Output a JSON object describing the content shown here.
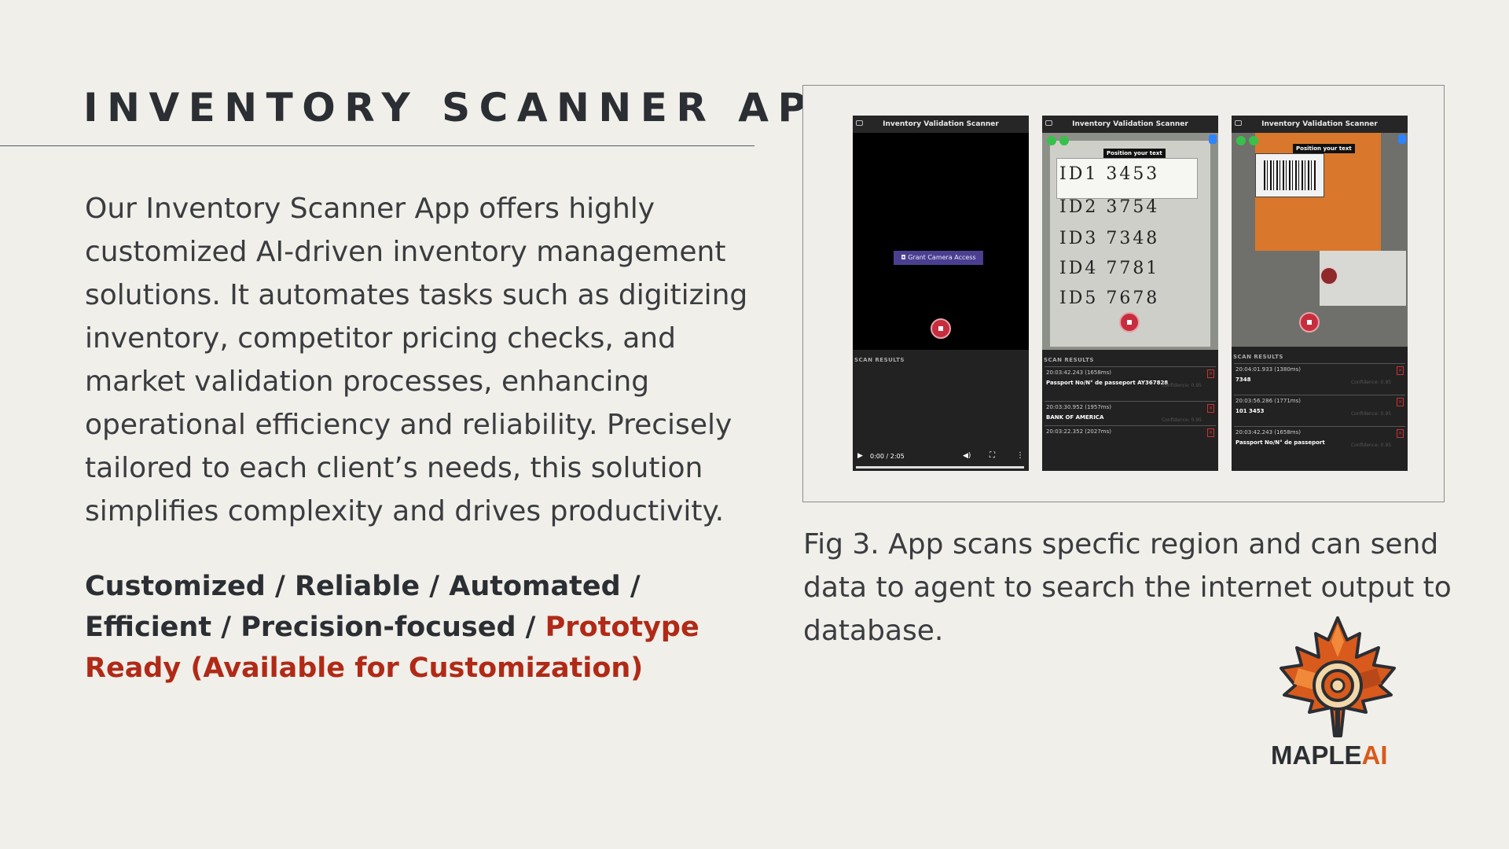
{
  "slide": {
    "title": "INVENTORY SCANNER APP",
    "description": "Our Inventory Scanner App offers highly customized AI-driven inventory management solutions. It automates tasks such as digitizing inventory, competitor pricing checks, and market validation processes, enhancing operational efficiency and reliability. Precisely tailored to each client’s needs, this solution simplifies complexity and drives productivity.",
    "tagline_main": "Customized / Reliable / Automated / Efficient / Precision-focused / ",
    "tagline_accent": "Prototype Ready (Available for Customization)",
    "caption": "Fig 3. App scans specfic region and can send data to agent to search the internet output to database.",
    "accent_color": "#b02a17"
  },
  "figure": {
    "screens": [
      {
        "header": "Inventory Validation Scanner",
        "grant_button": "Grant Camera Access",
        "results_title": "SCAN RESULTS",
        "video_time": "0:00 / 2:05"
      },
      {
        "header": "Inventory Validation Scanner",
        "position_label": "Position your text",
        "handwriting": [
          "ID1  3453",
          "ID2  3754",
          "ID3  7348",
          "ID4  7781",
          "ID5  7678"
        ],
        "results_title": "SCAN RESULTS",
        "results": [
          {
            "ts": "20:03:42.243 (1658ms)",
            "value": "Passport No/N° de passeport AY367828",
            "conf": "Confidence: 0.95"
          },
          {
            "ts": "20:03:30.952 (1957ms)",
            "value": "BANK OF AMERICA",
            "conf": "Confidence: 0.95"
          },
          {
            "ts": "20:03:22.352 (2027ms)",
            "value": "",
            "conf": ""
          }
        ]
      },
      {
        "header": "Inventory Validation Scanner",
        "position_label": "Position your text",
        "results_title": "SCAN RESULTS",
        "results": [
          {
            "ts": "20:04:01.933 (1380ms)",
            "value": "7348",
            "conf": "Confidence: 0.95"
          },
          {
            "ts": "20:03:56.286 (1771ms)",
            "value": "101 3453",
            "conf": "Confidence: 0.95"
          },
          {
            "ts": "20:03:42.243 (1658ms)",
            "value": "Passport No/N° de passeport",
            "conf": "Confidence: 0.95"
          }
        ]
      }
    ]
  },
  "logo": {
    "word1": "MAPLE",
    "word2": "AI",
    "icon": "maple-leaf-target-icon",
    "colors": {
      "leaf": "#d85a1c",
      "dark": "#2b2e33"
    }
  }
}
